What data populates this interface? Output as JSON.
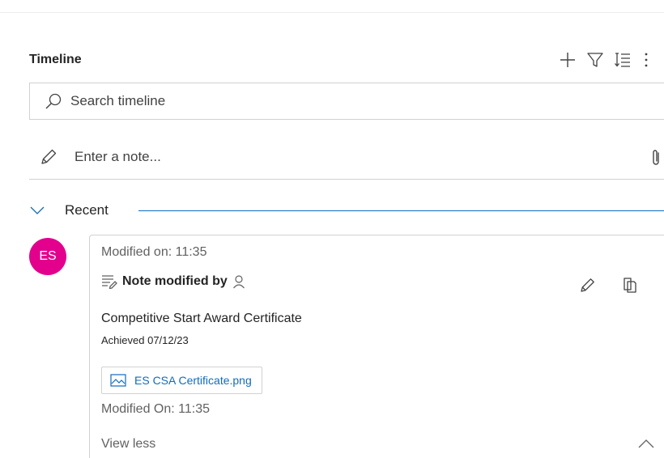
{
  "timeline": {
    "title": "Timeline",
    "actions": {
      "add_icon": "plus-icon",
      "filter_icon": "filter-icon",
      "sort_icon": "sort-icon",
      "more_icon": "more-vertical-icon"
    },
    "search": {
      "placeholder": "Search timeline"
    },
    "note": {
      "placeholder": "Enter a note..."
    },
    "group": {
      "label": "Recent"
    }
  },
  "entry": {
    "avatar_initials": "ES",
    "avatar_color": "#e3008c",
    "modified_on": "Modified on: 11:35",
    "subject": "Note modified by",
    "body_title": "Competitive Start Award Certificate",
    "body_detail": "Achieved 07/12/23",
    "attachment": {
      "name": "ES CSA Certificate.png",
      "icon": "image-file-icon"
    },
    "modified_on_2": "Modified On: 11:35",
    "view_less": "View less"
  },
  "colors": {
    "accent": "#0f6cbd",
    "border": "#d1d1d1",
    "muted_text": "#616161"
  }
}
